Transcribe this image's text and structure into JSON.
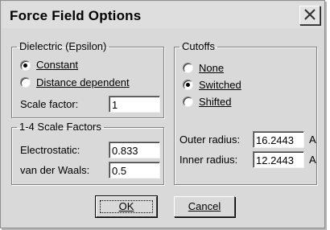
{
  "window": {
    "title": "Force Field Options",
    "close_icon": "close-icon"
  },
  "dielectric": {
    "legend": "Dielectric (Epsilon)",
    "options": [
      {
        "label": "Constant",
        "checked": true
      },
      {
        "label": "Distance dependent",
        "checked": false
      }
    ],
    "scale_factor_label": "Scale factor:",
    "scale_factor_value": "1"
  },
  "scale14": {
    "legend": "1-4 Scale Factors",
    "electrostatic_label": "Electrostatic:",
    "electrostatic_value": "0.833",
    "vdw_label": "van der Waals:",
    "vdw_value": "0.5"
  },
  "cutoffs": {
    "legend": "Cutoffs",
    "options": [
      {
        "label": "None",
        "checked": false
      },
      {
        "label": "Switched",
        "checked": true
      },
      {
        "label": "Shifted",
        "checked": false
      }
    ],
    "outer_label": "Outer radius:",
    "outer_value": "16.2443",
    "inner_label": "Inner radius:",
    "inner_value": "12.2443",
    "unit": "A"
  },
  "buttons": {
    "ok": "OK",
    "cancel": "Cancel"
  }
}
